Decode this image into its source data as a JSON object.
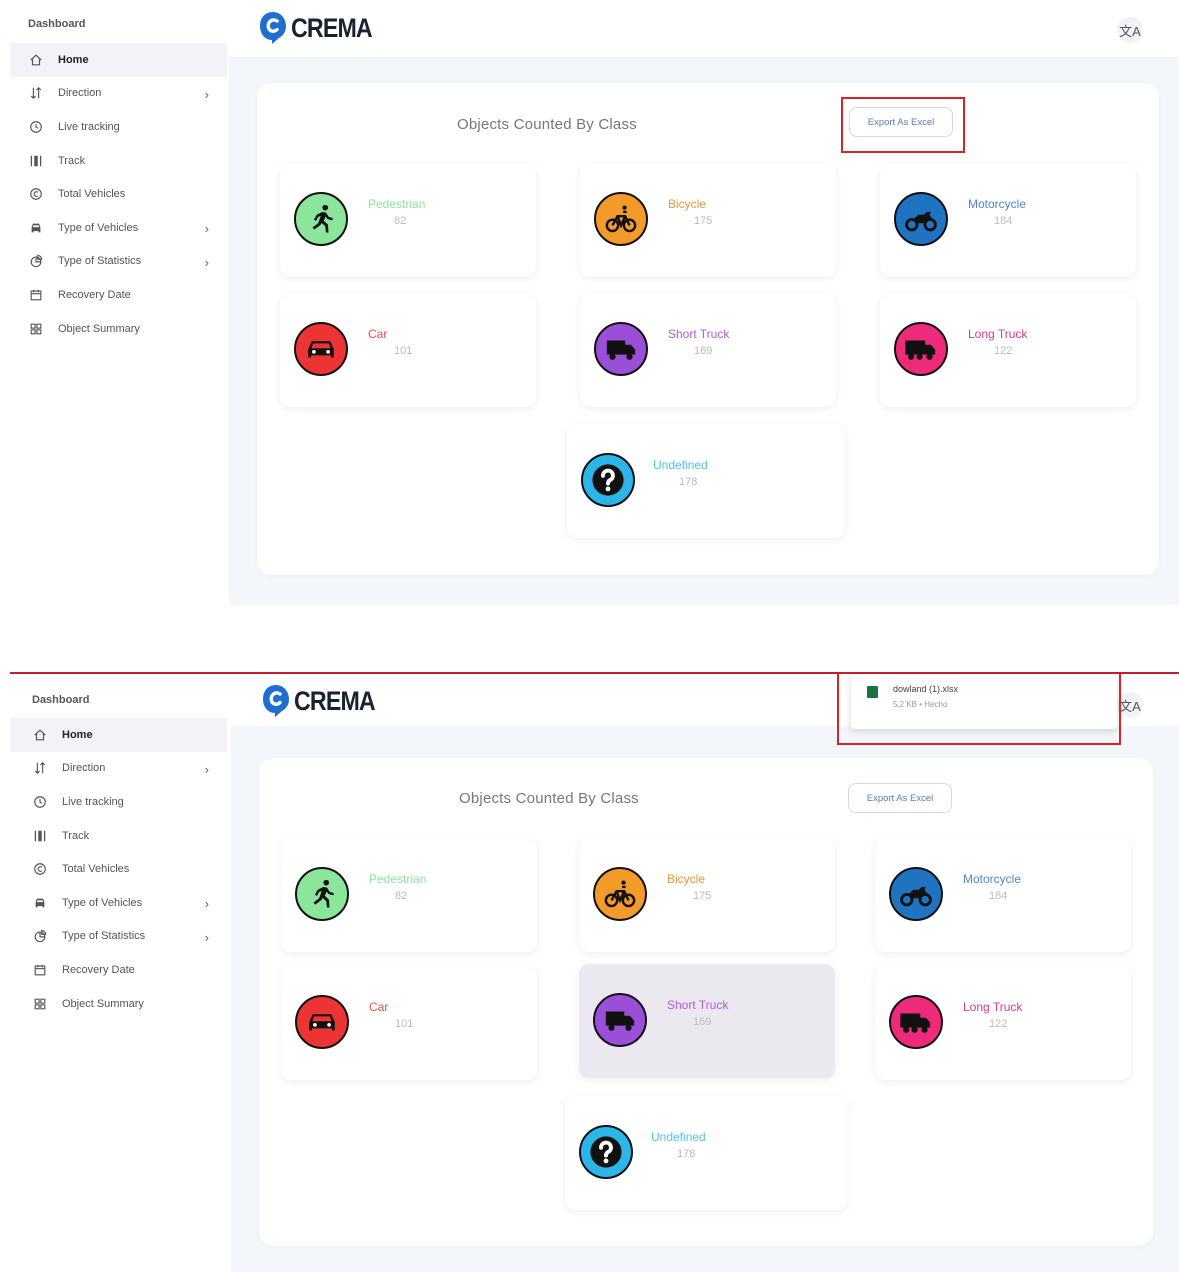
{
  "sidebar": {
    "title": "Dashboard",
    "items": [
      {
        "label": "Home",
        "icon": "home-icon"
      },
      {
        "label": "Direction",
        "icon": "direction-icon",
        "has_submenu": true
      },
      {
        "label": "Live tracking",
        "icon": "clock-icon"
      },
      {
        "label": "Track",
        "icon": "track-icon"
      },
      {
        "label": "Total Vehicles",
        "icon": "copyright-icon"
      },
      {
        "label": "Type of Vehicles",
        "icon": "car-icon",
        "has_submenu": true
      },
      {
        "label": "Type of Statistics",
        "icon": "pie-chart-icon",
        "has_submenu": true
      },
      {
        "label": "Recovery Date",
        "icon": "calendar-icon"
      },
      {
        "label": "Object Summary",
        "icon": "grid-icon"
      }
    ]
  },
  "header": {
    "logo_text": "CREMA",
    "language_icon": "translate-icon",
    "language_glyph": "文A"
  },
  "card": {
    "title": "Objects Counted By Class",
    "export_label": "Export As Excel"
  },
  "classes": [
    {
      "label": "Pedestrian",
      "value": "82",
      "color": "#8fe39b",
      "icon_bg": "#8be59a",
      "icon": "running-person-icon"
    },
    {
      "label": "Bicycle",
      "value": "175",
      "color": "#f0953b",
      "icon_bg": "#f39a2a",
      "icon": "bicycle-icon"
    },
    {
      "label": "Motorcycle",
      "value": "184",
      "color": "#4f86c6",
      "icon_bg": "#1f73c1",
      "icon": "motorcycle-icon"
    },
    {
      "label": "Car",
      "value": "101",
      "color": "#e84c4c",
      "icon_bg": "#ec3434",
      "icon": "car-icon"
    },
    {
      "label": "Short Truck",
      "value": "169",
      "color": "#b35ad8",
      "icon_bg": "#9b4fd9",
      "icon": "truck-icon"
    },
    {
      "label": "Long Truck",
      "value": "122",
      "color": "#d6407e",
      "icon_bg": "#ee2a7b",
      "icon": "truck-icon"
    },
    {
      "label": "Undefined",
      "value": "178",
      "color": "#4fc3e8",
      "icon_bg": "#2bb5e8",
      "icon": "question-icon"
    }
  ],
  "download": {
    "filename": "dowland (1).xlsx",
    "meta": "5,2 KB • Hecho"
  }
}
